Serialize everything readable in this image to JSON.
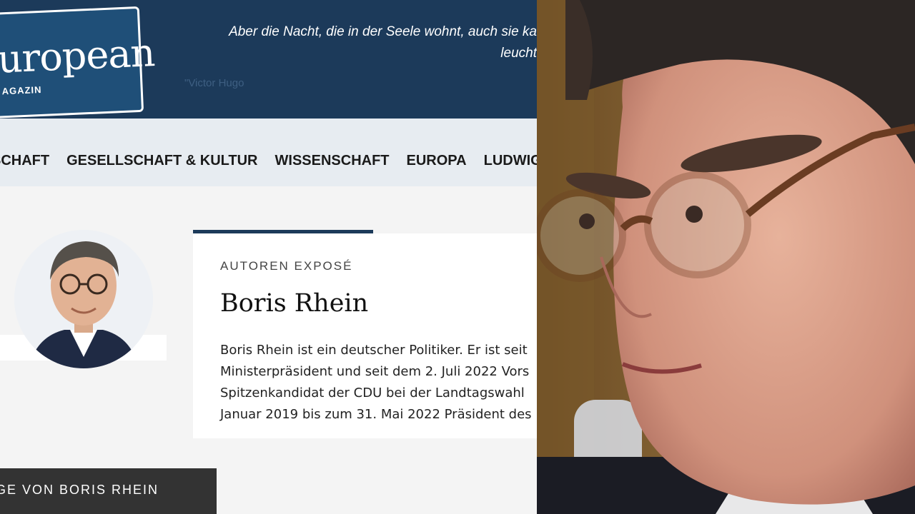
{
  "header": {
    "logo_word": "uropean",
    "logo_sub": "AGAZIN",
    "quote_line1": "Aber die Nacht, die in der Seele wohnt, auch sie ka",
    "quote_line2": "leucht",
    "quote_author": "\"Victor Hugo"
  },
  "nav": {
    "items": [
      "SCHAFT",
      "GESELLSCHAFT & KULTUR",
      "WISSENSCHAFT",
      "EUROPA",
      "LUDWIG-E"
    ]
  },
  "author": {
    "section_label": "AUTOREN EXPOSÉ",
    "name": "Boris Rhein",
    "bio_lines": [
      "Boris Rhein ist ein deutscher Politiker. Er ist seit",
      "Ministerpräsident und seit dem 2. Juli 2022 Vors",
      "Spitzenkandidat der CDU bei der Landtagswahl",
      "Januar 2019 bis zum 31. Mai 2022 Präsident des"
    ],
    "posts_button": "GE VON BORIS RHEIN"
  },
  "colors": {
    "masthead": "#1c3a5a",
    "logo_box": "#1f4f78",
    "nav_bg": "#e7ecf1",
    "accent": "#1c3a5a"
  }
}
